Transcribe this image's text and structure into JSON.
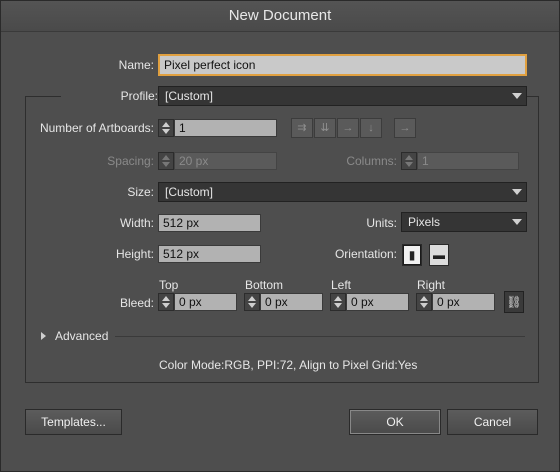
{
  "window": {
    "title": "New Document"
  },
  "name": {
    "label": "Name:",
    "value": "Pixel perfect icon"
  },
  "profile": {
    "label": "Profile:",
    "value": "[Custom]"
  },
  "artboards": {
    "label": "Number of Artboards:",
    "value": "1"
  },
  "spacing": {
    "label": "Spacing:",
    "value": "20 px"
  },
  "columns": {
    "label": "Columns:",
    "value": "1"
  },
  "size": {
    "label": "Size:",
    "value": "[Custom]"
  },
  "width": {
    "label": "Width:",
    "value": "512 px"
  },
  "units": {
    "label": "Units:",
    "value": "Pixels"
  },
  "height": {
    "label": "Height:",
    "value": "512 px"
  },
  "orientation": {
    "label": "Orientation:",
    "selected": "portrait"
  },
  "bleed": {
    "label": "Bleed:",
    "top": {
      "label": "Top",
      "value": "0 px"
    },
    "bottom": {
      "label": "Bottom",
      "value": "0 px"
    },
    "left": {
      "label": "Left",
      "value": "0 px"
    },
    "right": {
      "label": "Right",
      "value": "0 px"
    }
  },
  "advanced": {
    "label": "Advanced"
  },
  "summary": "Color Mode:RGB, PPI:72, Align to Pixel Grid:Yes",
  "buttons": {
    "templates": "Templates...",
    "ok": "OK",
    "cancel": "Cancel"
  },
  "colors": {
    "focus_border": "#e0a040",
    "dialog_bg": "#4e4e4e"
  }
}
